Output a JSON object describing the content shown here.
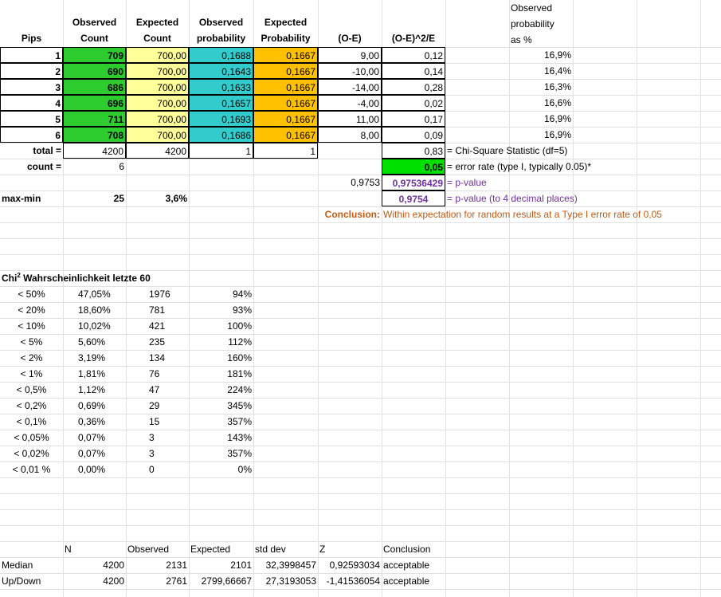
{
  "headers": {
    "pips": "Pips",
    "observed_count": [
      "Observed",
      "Count"
    ],
    "expected_count": [
      "Expected",
      "Count"
    ],
    "observed_prob": [
      "Observed",
      "probability"
    ],
    "expected_prob": [
      "Expected",
      "Probability"
    ],
    "o_minus_e": "(O-E)",
    "chi_term": "(O-E)^2/E",
    "obs_pct": [
      "Observed",
      "probability",
      "as %"
    ]
  },
  "rows": [
    {
      "pip": "1",
      "obs": "709",
      "exp": "700,00",
      "op": "0,1688",
      "ep": "0,1667",
      "oe": "9,00",
      "chi": "0,12",
      "pct": "16,9%"
    },
    {
      "pip": "2",
      "obs": "690",
      "exp": "700,00",
      "op": "0,1643",
      "ep": "0,1667",
      "oe": "-10,00",
      "chi": "0,14",
      "pct": "16,4%"
    },
    {
      "pip": "3",
      "obs": "686",
      "exp": "700,00",
      "op": "0,1633",
      "ep": "0,1667",
      "oe": "-14,00",
      "chi": "0,28",
      "pct": "16,3%"
    },
    {
      "pip": "4",
      "obs": "696",
      "exp": "700,00",
      "op": "0,1657",
      "ep": "0,1667",
      "oe": "-4,00",
      "chi": "0,02",
      "pct": "16,6%"
    },
    {
      "pip": "5",
      "obs": "711",
      "exp": "700,00",
      "op": "0,1693",
      "ep": "0,1667",
      "oe": "11,00",
      "chi": "0,17",
      "pct": "16,9%"
    },
    {
      "pip": "6",
      "obs": "708",
      "exp": "700,00",
      "op": "0,1686",
      "ep": "0,1667",
      "oe": "8,00",
      "chi": "0,09",
      "pct": "16,9%"
    }
  ],
  "totals": {
    "total_label": "total =",
    "total_obs": "4200",
    "total_exp": "4200",
    "total_op": "1",
    "total_ep": "1",
    "chi_sum": "0,83",
    "chi_sum_label": "= Chi-Square Statistic (df=5)",
    "count_label": "count =",
    "count_val": "6",
    "error_rate": "0,05",
    "error_rate_label": "= error rate (type I, typically 0.05)*",
    "p_raw": "0,9753",
    "p_value": "0,97536429",
    "p_value_label": "= p-value",
    "p_rounded": "0,9754",
    "p_rounded_label": "= p-value (to 4 decimal places)",
    "maxmin_label": "max-min",
    "maxmin_val": "25",
    "maxmin_pct": "3,6%",
    "conclusion_label": "Conclusion:",
    "conclusion_text": "Within expectation for random results at a Type I error rate of 0,05"
  },
  "chi_table": {
    "title_pre": "Chi",
    "title_sup": "2",
    "title_post": " Wahrscheinlichkeit letzte 60",
    "rows": [
      {
        "a": "< 50%",
        "b": "47,05%",
        "c": "1976",
        "d": "94%"
      },
      {
        "a": "< 20%",
        "b": "18,60%",
        "c": "781",
        "d": "93%"
      },
      {
        "a": "< 10%",
        "b": "10,02%",
        "c": "421",
        "d": "100%"
      },
      {
        "a": "< 5%",
        "b": "5,60%",
        "c": "235",
        "d": "112%"
      },
      {
        "a": "< 2%",
        "b": "3,19%",
        "c": "134",
        "d": "160%"
      },
      {
        "a": "< 1%",
        "b": "1,81%",
        "c": "76",
        "d": "181%"
      },
      {
        "a": "< 0,5%",
        "b": "1,12%",
        "c": "47",
        "d": "224%"
      },
      {
        "a": "< 0,2%",
        "b": "0,69%",
        "c": "29",
        "d": "345%"
      },
      {
        "a": "< 0,1%",
        "b": "0,36%",
        "c": "15",
        "d": "357%"
      },
      {
        "a": "< 0,05%",
        "b": "0,07%",
        "c": "3",
        "d": "143%"
      },
      {
        "a": "< 0,02%",
        "b": "0,07%",
        "c": "3",
        "d": "357%"
      },
      {
        "a": "< 0,01 %",
        "b": "0,00%",
        "c": "0",
        "d": "0%"
      }
    ]
  },
  "bottom": {
    "headers": {
      "n": "N",
      "observed": "Observed",
      "expected": "Expected",
      "stddev": "std dev",
      "z": "Z",
      "conclusion": "Conclusion"
    },
    "rows": [
      {
        "label": "Median",
        "n": "4200",
        "observed": "2131",
        "expected": "2101",
        "stddev": "32,3998457",
        "z": "0,92593034",
        "conclusion": "acceptable"
      },
      {
        "label": "Up/Down",
        "n": "4200",
        "observed": "2761",
        "expected": "2799,66667",
        "stddev": "27,3193053",
        "z": "-1,41536054",
        "conclusion": "acceptable"
      }
    ]
  }
}
